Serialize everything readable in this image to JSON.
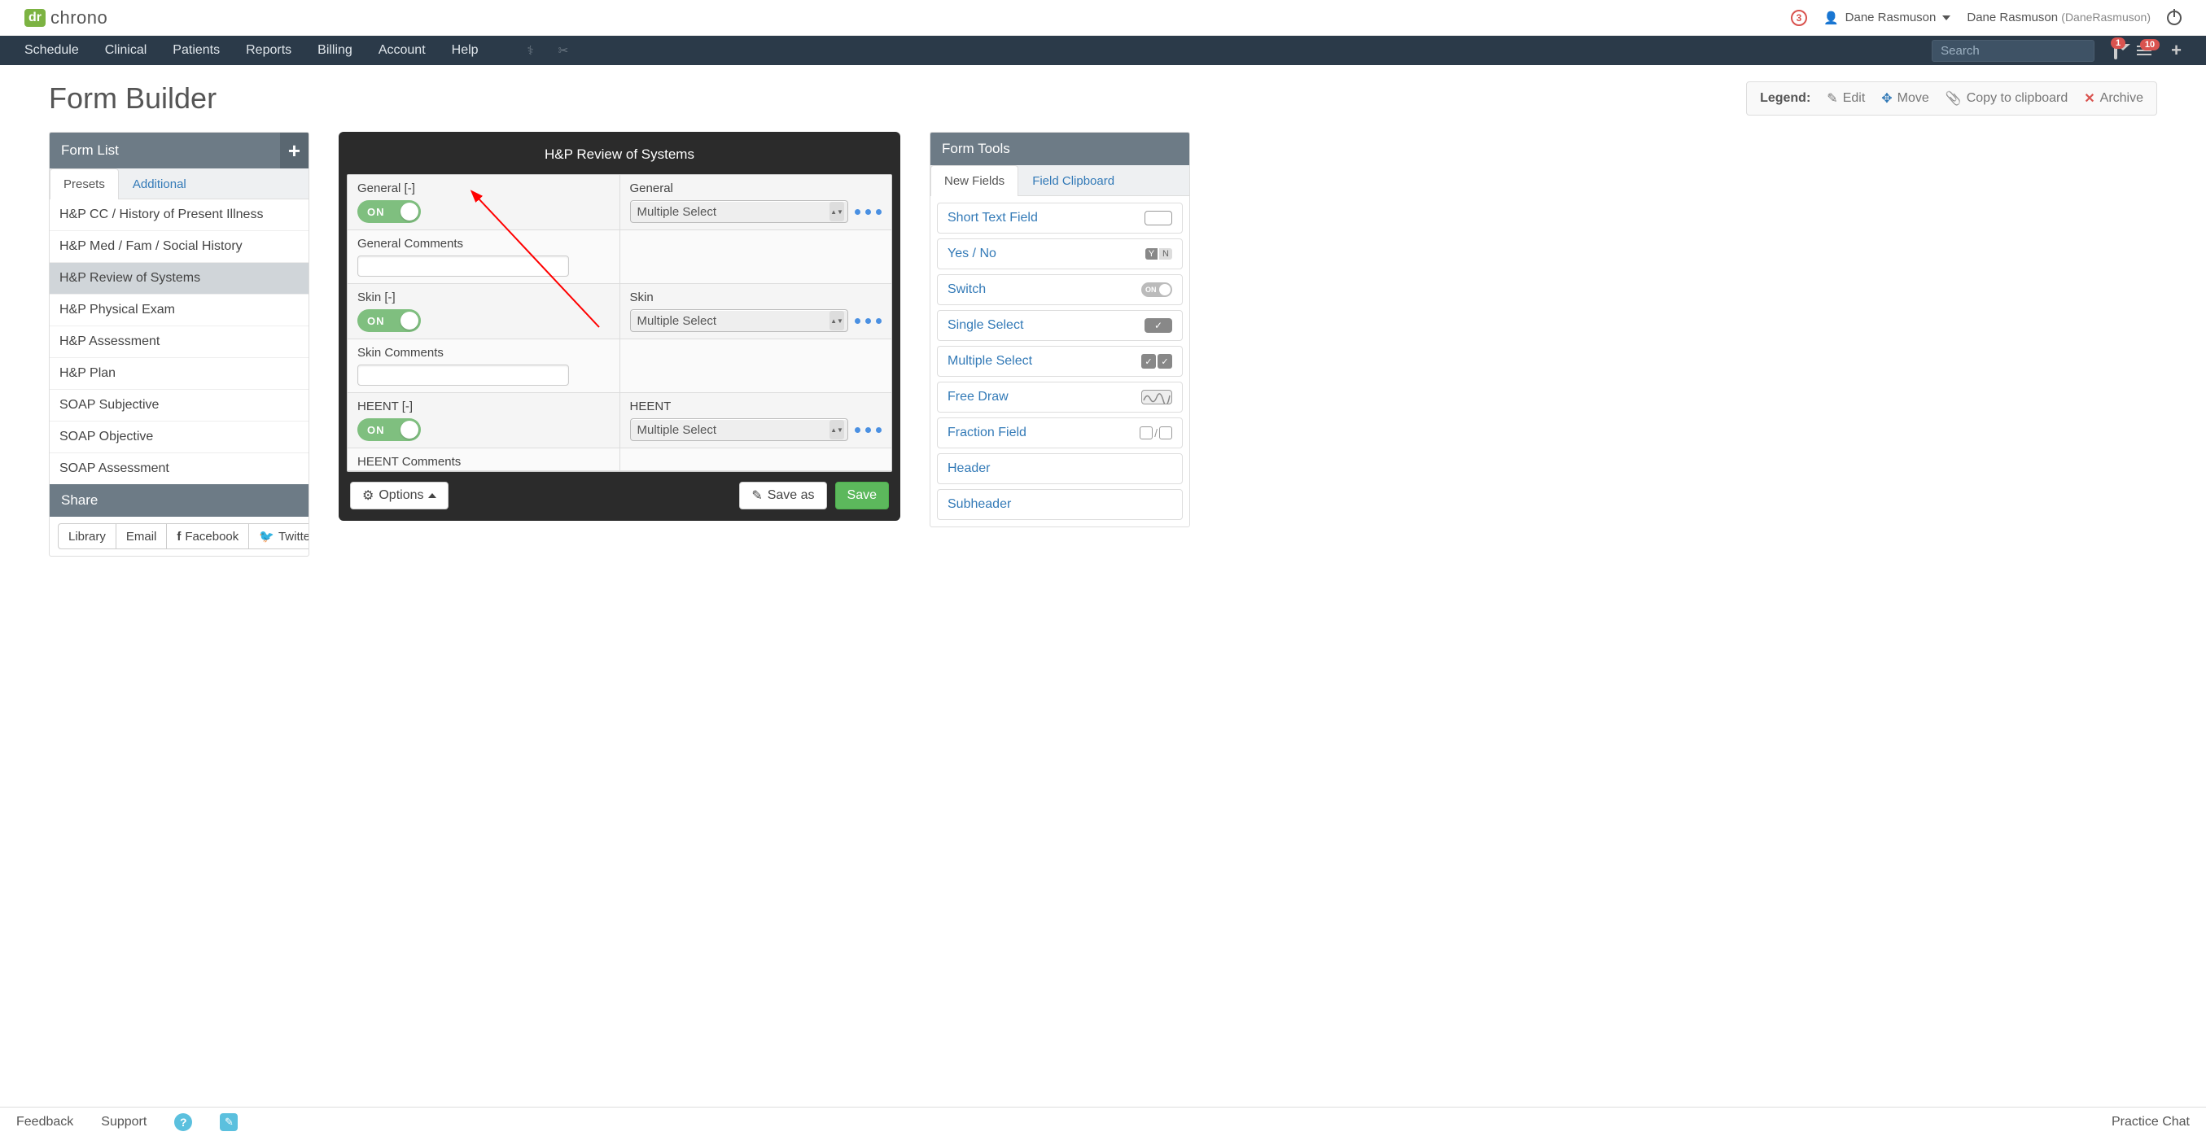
{
  "topbar": {
    "logo_badge": "dr",
    "logo_text": "chrono",
    "notif_count": "3",
    "user_name": "Dane Rasmuson",
    "user_full": "Dane Rasmuson",
    "user_handle": "(DaneRasmuson)"
  },
  "nav": {
    "items": [
      "Schedule",
      "Clinical",
      "Patients",
      "Reports",
      "Billing",
      "Account",
      "Help"
    ],
    "search_placeholder": "Search",
    "inbox_badge": "1",
    "menu_badge": "10"
  },
  "page": {
    "title": "Form Builder"
  },
  "legend": {
    "label": "Legend:",
    "edit": "Edit",
    "move": "Move",
    "copy": "Copy to clipboard",
    "archive": "Archive"
  },
  "form_list": {
    "header": "Form List",
    "tabs": [
      "Presets",
      "Additional"
    ],
    "active_tab": 0,
    "items": [
      "H&P CC / History of Present Illness",
      "H&P Med / Fam / Social History",
      "H&P Review of Systems",
      "H&P Physical Exam",
      "H&P Assessment",
      "H&P Plan",
      "SOAP Subjective",
      "SOAP Objective",
      "SOAP Assessment"
    ],
    "selected_index": 2
  },
  "share": {
    "header": "Share",
    "buttons": [
      "Library",
      "Email",
      "Facebook",
      "Twitter"
    ]
  },
  "editor": {
    "title": "H&P Review of Systems",
    "rows": [
      {
        "left_label": "General [-]",
        "right_label": "General",
        "right_type": "Multiple Select",
        "toggle": "ON"
      },
      {
        "left_label": "General Comments",
        "right_label": "",
        "right_type": "",
        "input": true
      },
      {
        "left_label": "Skin [-]",
        "right_label": "Skin",
        "right_type": "Multiple Select",
        "toggle": "ON"
      },
      {
        "left_label": "Skin Comments",
        "right_label": "",
        "right_type": "",
        "input": true
      },
      {
        "left_label": "HEENT [-]",
        "right_label": "HEENT",
        "right_type": "Multiple Select",
        "toggle": "ON"
      },
      {
        "left_label": "HEENT Comments",
        "right_label": "",
        "right_type": "",
        "input": true
      }
    ],
    "options_label": "Options",
    "save_as_label": "Save as",
    "save_label": "Save"
  },
  "tools": {
    "header": "Form Tools",
    "tabs": [
      "New Fields",
      "Field Clipboard"
    ],
    "active_tab": 0,
    "items": [
      "Short Text Field",
      "Yes / No",
      "Switch",
      "Single Select",
      "Multiple Select",
      "Free Draw",
      "Fraction Field",
      "Header",
      "Subheader"
    ]
  },
  "footer": {
    "feedback": "Feedback",
    "support": "Support",
    "chat": "Practice Chat"
  }
}
